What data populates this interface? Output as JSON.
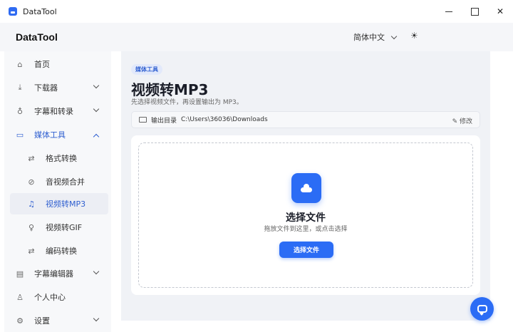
{
  "window": {
    "title": "DataTool"
  },
  "header": {
    "brand": "DataTool",
    "language": "简体中文"
  },
  "sidebar": {
    "items": [
      {
        "label": "首页",
        "icon": "home-icon"
      },
      {
        "label": "下载器",
        "icon": "download-icon"
      },
      {
        "label": "字幕和转录",
        "icon": "microphone-icon"
      },
      {
        "label": "媒体工具",
        "icon": "video-icon"
      },
      {
        "label": "格式转换",
        "icon": "swap-icon"
      },
      {
        "label": "音视频合并",
        "icon": "link-icon"
      },
      {
        "label": "视频转MP3",
        "icon": "music-icon"
      },
      {
        "label": "视频转GIF",
        "icon": "bulb-icon"
      },
      {
        "label": "编码转换",
        "icon": "swap-icon"
      },
      {
        "label": "字幕编辑器",
        "icon": "subtitle-icon"
      },
      {
        "label": "个人中心",
        "icon": "user-icon"
      },
      {
        "label": "设置",
        "icon": "gear-icon"
      }
    ]
  },
  "main": {
    "badge": "媒体工具",
    "title": "视频转MP3",
    "subtitle": "先选择视频文件，再设置输出为 MP3。",
    "output": {
      "label": "输出目录",
      "path": "C:\\Users\\36036\\Downloads",
      "edit_label": "修改"
    },
    "dropzone": {
      "title": "选择文件",
      "hint": "拖放文件到这里，或点击选择",
      "button_label": "选择文件"
    }
  },
  "colors": {
    "accent": "#2b6cf5",
    "active_text": "#2f5fd0"
  }
}
